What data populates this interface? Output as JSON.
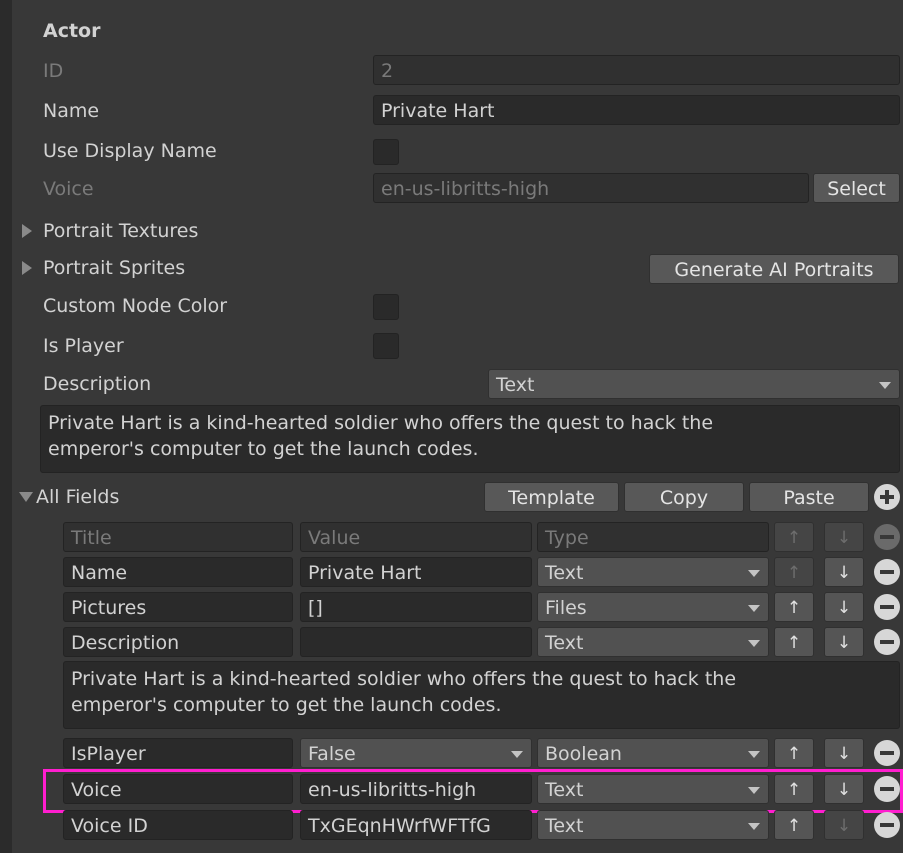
{
  "actor": {
    "header": "Actor",
    "id_label": "ID",
    "id_value": "2",
    "name_label": "Name",
    "name_value": "Private Hart",
    "use_display_name_label": "Use Display Name",
    "voice_label": "Voice",
    "voice_value": "en-us-libritts-high",
    "voice_select_label": "Select",
    "portrait_textures_label": "Portrait Textures",
    "portrait_sprites_label": "Portrait Sprites",
    "generate_portraits_label": "Generate AI Portraits",
    "custom_node_color_label": "Custom Node Color",
    "is_player_label": "Is Player",
    "description_label": "Description",
    "description_type": "Text",
    "description_text": "Private Hart is a kind-hearted soldier who offers the quest to hack the\nemperor's computer to get the launch codes."
  },
  "all_fields": {
    "label": "All Fields",
    "template_label": "Template",
    "copy_label": "Copy",
    "paste_label": "Paste",
    "header": {
      "title": "Title",
      "value": "Value",
      "type": "Type"
    },
    "up_arrow": "↑",
    "down_arrow": "↓",
    "rows": [
      {
        "title": "Name",
        "value": "Private Hart",
        "type": "Text"
      },
      {
        "title": "Pictures",
        "value": "[]",
        "type": "Files"
      },
      {
        "title": "Description",
        "value": "",
        "type": "Text"
      },
      {
        "title": "IsPlayer",
        "value": "False",
        "type": "Boolean"
      },
      {
        "title": "Voice",
        "value": "en-us-libritts-high",
        "type": "Text"
      },
      {
        "title": "Voice ID",
        "value": "TxGEqnHWrfWFTfG",
        "type": "Text"
      }
    ],
    "description_text": "Private Hart is a kind-hearted soldier who offers the quest to hack the\nemperor's computer to get the launch codes."
  },
  "colors": {
    "background": "#383838",
    "highlight": "#ff1ecf"
  }
}
